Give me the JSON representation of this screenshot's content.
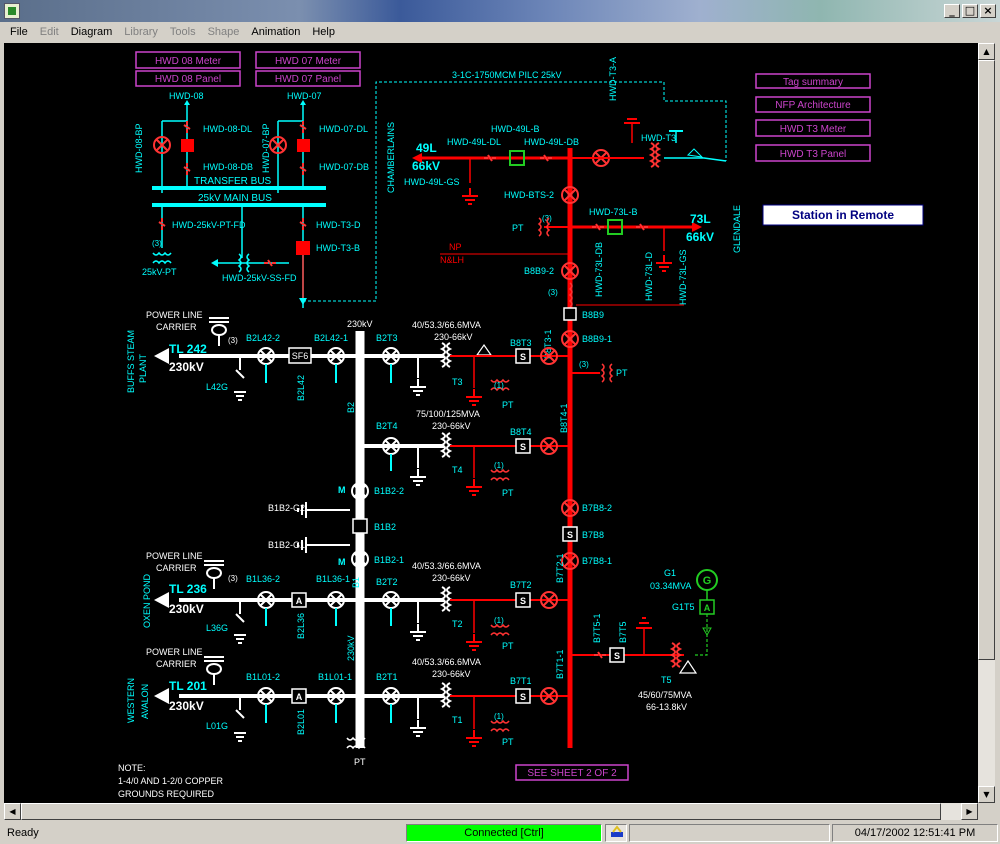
{
  "window": {
    "minimize": "_",
    "maximize": "□",
    "close": "×"
  },
  "menu": [
    "File",
    "Edit",
    "Diagram",
    "Library",
    "Tools",
    "Shape",
    "Animation",
    "Help"
  ],
  "buttons": {
    "hwd08_meter": "HWD 08 Meter",
    "hwd08_panel": "HWD 08 Panel",
    "hwd07_meter": "HWD 07 Meter",
    "hwd07_panel": "HWD 07 Panel",
    "tag_summary": "Tag summary",
    "nfp_arch": "NFP Architecture",
    "t3_meter": "HWD T3 Meter",
    "t3_panel": "HWD T3 Panel",
    "station_remote": "Station in Remote",
    "see_sheet": "SEE SHEET 2 OF 2"
  },
  "labels": {
    "cable": "3-1C-1750MCM PILC 25kV",
    "hwd08": "HWD-08",
    "hwd07": "HWD-07",
    "hwd08bp": "HWD-08-BP",
    "hwd07bp": "HWD-07-BP",
    "hwd08dl": "HWD-08-DL",
    "hwd07dl": "HWD-07-DL",
    "hwd08db": "HWD-08-DB",
    "hwd07db": "HWD-07-DB",
    "transfer_bus": "TRANSFER BUS",
    "main_bus": "25kV MAIN BUS",
    "pt_fd": "HWD-25kV-PT-FD",
    "t3d": "HWD-T3-D",
    "t3b": "HWD-T3-B",
    "ss_fd": "HWD-25kV-SS-FD",
    "pt25": "25kV-PT",
    "three": "(3)",
    "one": "(1)",
    "chamberlains": "CHAMBERLAINS",
    "l49": "49L",
    "kv66": "66kV",
    "l49b": "HWD-49L-B",
    "l49dl": "HWD-49L-DL",
    "l49db": "HWD-49L-DB",
    "l49gs": "HWD-49L-GS",
    "t3a": "HWD-T3-A",
    "t3": "HWD-T3",
    "bts2": "HWD-BTS-2",
    "l73b": "HWD-73L-B",
    "l73": "73L",
    "glendale": "GLENDALE",
    "pt": "PT",
    "np": "NP",
    "nlh": "N&LH",
    "l73db": "HWD-73L-DB",
    "l73d": "HWD-73L-D",
    "l73gs": "HWD-73L-GS",
    "b8b9_2": "B8B9-2",
    "b8b9": "B8B9",
    "b8b9_1": "B8B9-1",
    "plc": "POWER LINE",
    "carrier": "CARRIER",
    "kv230": "230kV",
    "tl242": "TL 242",
    "tl236": "TL 236",
    "tl201": "TL 201",
    "buffs": "BUFFS STEAM",
    "plant": "PLANT",
    "oxen": "OXEN POND",
    "western": "WESTERN",
    "avalon": "AVALON",
    "b2l42_2": "B2L42-2",
    "b2l42_1": "B2L42-1",
    "sf6": "SF6",
    "b2l42": "B2L42",
    "l42g": "L42G",
    "b2t3": "B2T3",
    "b2t4": "B2T4",
    "b2": "B2",
    "mva_t3": "40/53.3/66.6MVA",
    "kv_t3": "230-66kV",
    "t3n": "T3",
    "mva_t4": "75/100/125MVA",
    "kv_t4": "230-66kV",
    "t4n": "T4",
    "b8t3": "B8T3",
    "b8t3_1": "B8T3-1",
    "b8t4": "B8T4",
    "b8t4_1": "B8T4-1",
    "s": "S",
    "b7b8_2": "B7B8-2",
    "b7b8": "B7B8",
    "b7b8_1": "B7B8-1",
    "b1b2_g2": "B1B2-G2",
    "b1b2_g1": "B1B2-G1",
    "b1b2_2": "B1B2-2",
    "b1b2_1": "B1B2-1",
    "b1b2": "B1B2",
    "m": "M",
    "b1l36_2": "B1L36-2",
    "b1l36_1": "B1L36-1",
    "b2l36": "B2L36",
    "l36g": "L36G",
    "a": "A",
    "b2t2": "B2T2",
    "mva_t2": "40/53.3/66.6MVA",
    "kv_t2": "230-66kV",
    "t2n": "T2",
    "b7t2": "B7T2",
    "b7t2_1": "B7T2-1",
    "g1": "G1",
    "g1mva": "03.34MVA",
    "g1t5": "G1T5",
    "g": "G",
    "b7t5_1": "B7T5-1",
    "b7t5": "B7T5",
    "t5n": "T5",
    "mva_t5": "45/60/75MVA",
    "kv_t5": "66-13.8kV",
    "b1l01_2": "B1L01-2",
    "b1l01_1": "B1L01-1",
    "b2l01": "B2L01",
    "l01g": "L01G",
    "b2t1": "B2T1",
    "mva_t1": "40/53.3/66.6MVA",
    "kv_t1": "230-66kV",
    "t1n": "T1",
    "b7t1": "B7T1",
    "b7t1_1": "B7T1-1",
    "b1": "B1",
    "note": "NOTE:",
    "note1": "1-4/0 AND 1-2/0 COPPER",
    "note2": "GROUNDS REQUIRED"
  },
  "status": {
    "ready": "Ready",
    "connected": "Connected [Ctrl]",
    "datetime": "04/17/2002 12:51:41 PM"
  },
  "colors": {
    "background": "#000000",
    "bus_white": "#ffffff",
    "live_red": "#ff0000",
    "label_cyan": "#00ffff",
    "button_magenta": "#cc44cc",
    "generator_green": "#22cc22",
    "connected_green": "#00ff00"
  }
}
